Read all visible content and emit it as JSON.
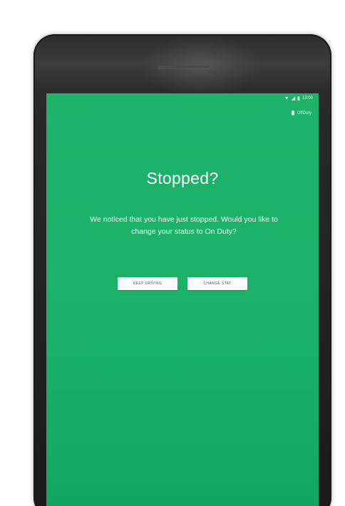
{
  "status_bar": {
    "icons": [
      "wifi-icon",
      "signal-icon",
      "battery-icon"
    ],
    "time": "13:00"
  },
  "app_status": {
    "icon": "driver-icon",
    "label": "OffDuty"
  },
  "dialog": {
    "title": "Stopped?",
    "message": "We noticed that you have just stopped. Would you like to change your status to On Duty?",
    "keep_button": "KEEP DRIVING",
    "change_button": "CHANGE STAT"
  },
  "colors": {
    "screen_green": "#1ab068",
    "device_frame": "#1f1f1f",
    "button_bg": "#ffffff"
  }
}
